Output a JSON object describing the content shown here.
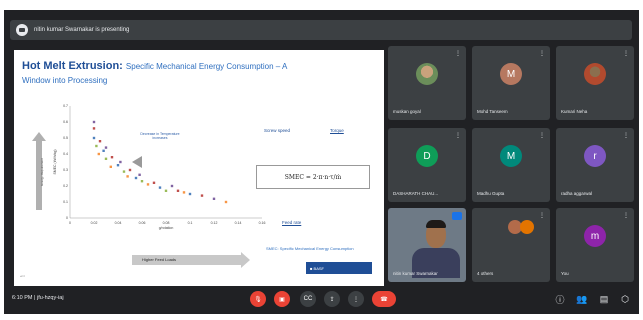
{
  "meeting": {
    "presenting_text": "nitin kumar Swarnakar is presenting"
  },
  "slide": {
    "title_bold": "Hot Melt Extrusion:",
    "title_rest": "Specific Mechanical Energy Consumption – A",
    "title_line2": "Window into Processing",
    "energy_label": "Energy Requirement",
    "y_axis_label": "SMEC (kWh/kg)",
    "decrease_note": "Decrease in Temperature increases",
    "x_axis_label": "g/rotation",
    "feed_arrow_label": "Higher Feed Loads",
    "screw_speed_label": "Screw speed",
    "torque_label": "Torque",
    "feed_rate_label": "Feed rate",
    "formula_text": "SMEC = 2·π·n·τ/ṁ",
    "footer_note": "SMEC: Specific Mechanical Energy Consumption",
    "brand_box": "■ BASF",
    "bottom_left": "◂  ⊡"
  },
  "chart_data": {
    "type": "scatter",
    "xlabel": "g/rotation",
    "ylabel": "SMEC (kWh/kg)",
    "x_ticks": [
      "0",
      "0.02",
      "0.04",
      "0.06",
      "0.08",
      "0.1",
      "0.12",
      "0.14",
      "0.16"
    ],
    "y_ticks": [
      "0",
      "0.1",
      "0.2",
      "0.3",
      "0.4",
      "0.5",
      "0.6",
      "0.7"
    ],
    "xlim": [
      0,
      0.16
    ],
    "ylim": [
      0,
      0.7
    ],
    "series": [
      {
        "color": "#c0504d",
        "points": [
          [
            0.02,
            0.56
          ],
          [
            0.025,
            0.48
          ],
          [
            0.035,
            0.38
          ],
          [
            0.05,
            0.3
          ],
          [
            0.07,
            0.22
          ],
          [
            0.09,
            0.17
          ],
          [
            0.11,
            0.14
          ]
        ]
      },
      {
        "color": "#4f81bd",
        "points": [
          [
            0.02,
            0.5
          ],
          [
            0.028,
            0.42
          ],
          [
            0.04,
            0.33
          ],
          [
            0.055,
            0.25
          ],
          [
            0.075,
            0.19
          ],
          [
            0.1,
            0.15
          ]
        ]
      },
      {
        "color": "#9bbb59",
        "points": [
          [
            0.022,
            0.45
          ],
          [
            0.03,
            0.37
          ],
          [
            0.045,
            0.29
          ],
          [
            0.06,
            0.23
          ],
          [
            0.08,
            0.17
          ]
        ]
      },
      {
        "color": "#8064a2",
        "points": [
          [
            0.02,
            0.6
          ],
          [
            0.03,
            0.44
          ],
          [
            0.042,
            0.35
          ],
          [
            0.058,
            0.27
          ],
          [
            0.085,
            0.2
          ],
          [
            0.12,
            0.12
          ]
        ]
      },
      {
        "color": "#f79646",
        "points": [
          [
            0.024,
            0.4
          ],
          [
            0.034,
            0.32
          ],
          [
            0.048,
            0.26
          ],
          [
            0.065,
            0.21
          ],
          [
            0.095,
            0.16
          ],
          [
            0.13,
            0.1
          ]
        ]
      }
    ]
  },
  "participants": [
    {
      "name": "muskan goyal",
      "kind": "photo"
    },
    {
      "name": "Mohd Tanseem",
      "kind": "letter",
      "initial": "M",
      "color": "#b67860"
    },
    {
      "name": "Kumari Neha",
      "kind": "photo2"
    },
    {
      "name": "DASHARATH CHAU...",
      "kind": "letter",
      "initial": "D",
      "color": "#0f9d58"
    },
    {
      "name": "Madhu Gupta",
      "kind": "letter",
      "initial": "M",
      "color": "#00897b"
    },
    {
      "name": "radha aggarwal",
      "kind": "letter",
      "initial": "r",
      "color": "#7e57c2"
    },
    {
      "name": "nitin kumar Swarnakar",
      "kind": "presenter"
    },
    {
      "name": "4 others",
      "kind": "others"
    },
    {
      "name": "You",
      "kind": "letter",
      "initial": "m",
      "color": "#8e24aa"
    }
  ],
  "bottom": {
    "time_text": "6:10 PM  |  jfu-hzqy-iaj",
    "controls": [
      "mic-off",
      "camera-off",
      "captions",
      "present",
      "more",
      "end-call"
    ]
  }
}
